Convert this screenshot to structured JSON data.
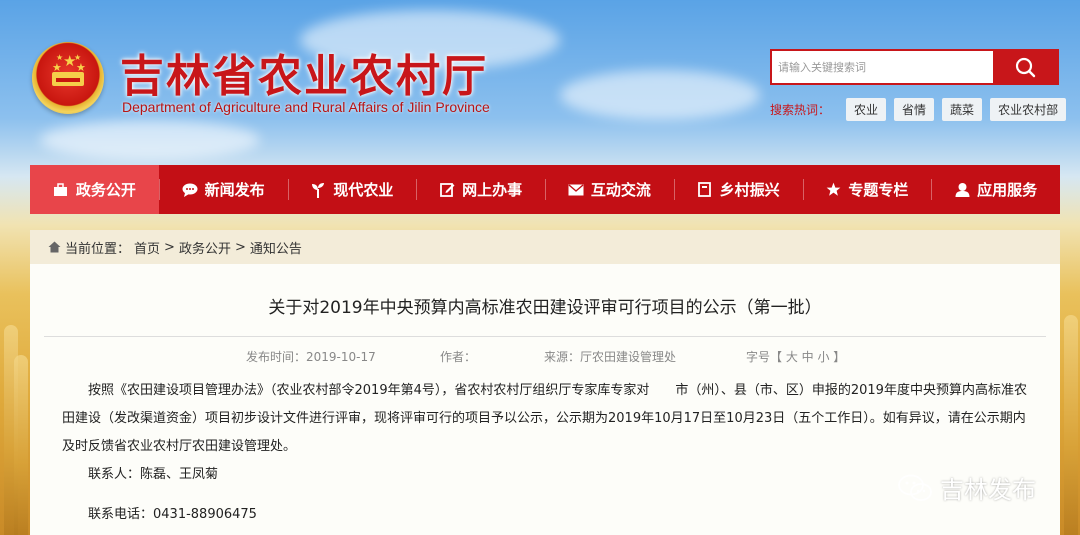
{
  "header": {
    "title": "吉林省农业农村厅",
    "subtitle": "Department of Agriculture and Rural Affairs of Jilin Province"
  },
  "search": {
    "placeholder": "请输入关键搜索词",
    "hot_label": "搜索热词：",
    "hot_tags": [
      "农业",
      "省情",
      "蔬菜",
      "农业农村部"
    ]
  },
  "nav": {
    "items": [
      {
        "label": "政务公开",
        "icon": "briefcase-icon",
        "active": true
      },
      {
        "label": "新闻发布",
        "icon": "chat-bubble-icon"
      },
      {
        "label": "现代农业",
        "icon": "sprout-icon"
      },
      {
        "label": "网上办事",
        "icon": "edit-icon"
      },
      {
        "label": "互动交流",
        "icon": "mail-icon"
      },
      {
        "label": "乡村振兴",
        "icon": "book-icon"
      },
      {
        "label": "专题专栏",
        "icon": "star-icon"
      },
      {
        "label": "应用服务",
        "icon": "user-icon"
      }
    ]
  },
  "breadcrumb": {
    "prefix": "当前位置：",
    "items": [
      "首页",
      "政务公开",
      "通知公告"
    ],
    "separator": ">"
  },
  "article": {
    "title": "关于对2019年中央预算内高标准农田建设评审可行项目的公示（第一批）",
    "published": "发布时间：2019-10-17",
    "author": "作者：",
    "source": "来源：厅农田建设管理处",
    "font_size": "字号【 大 中 小 】",
    "paragraph": "按照《农田建设项目管理办法》（农业农村部令2019年第4号），省农村农村厅组织厅专家库专家对　　市（州）、县（市、区）申报的2019年度中央预算内高标准农田建设（发改渠道资金）项目初步设计文件进行评审，现将评审可行的项目予以公示，公示期为2019年10月17日至10月23日（五个工作日）。如有异议，请在公示期内及时反馈省农业农村厅农田建设管理处。",
    "contact_person": "联系人：陈磊、王凤菊",
    "contact_phone": "联系电话：0431-88906475"
  },
  "watermark": {
    "text": "吉林发布"
  },
  "colors": {
    "brand_red": "#c30f15",
    "active_nav": "#e8454a",
    "crumb_bg": "#f3ecd9"
  }
}
